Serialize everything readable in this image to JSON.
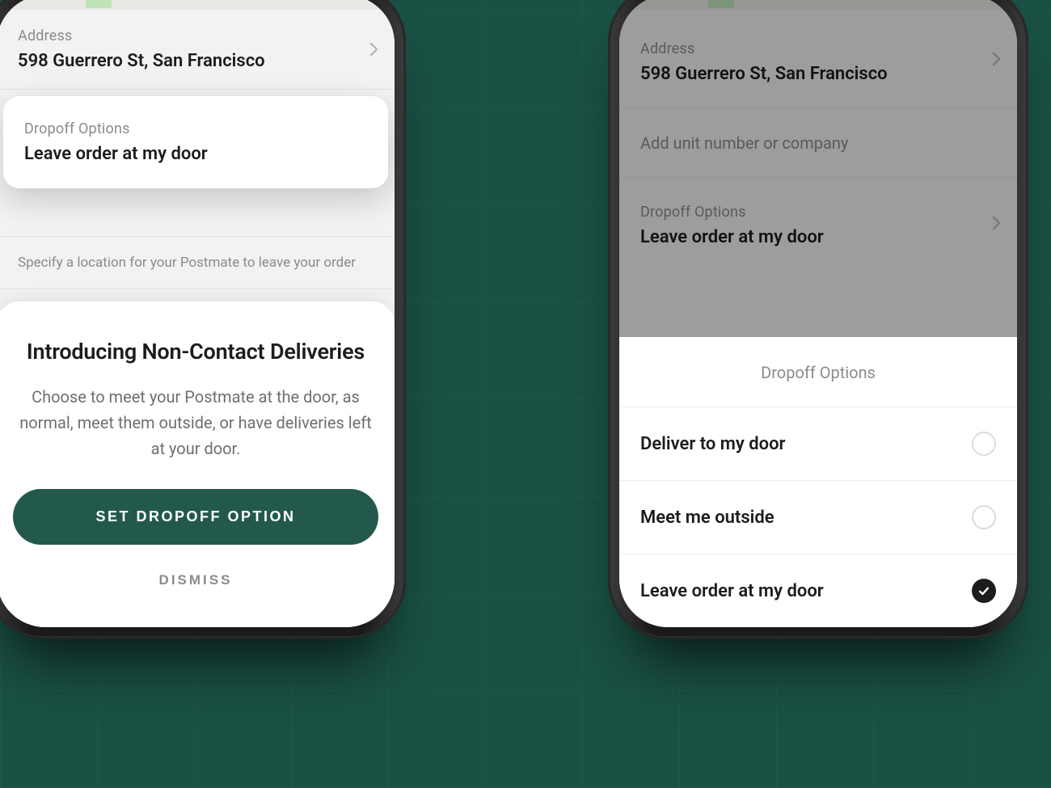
{
  "left": {
    "address_label": "Address",
    "address_value": "598 Guerrero St, San Francisco",
    "dropoff_label": "Dropoff Options",
    "dropoff_value": "Leave order at my door",
    "helper_text": "Specify a location for your Postmate to leave your order",
    "promo": {
      "title": "Introducing Non-Contact Deliveries",
      "body": "Choose to meet your Postmate at the door, as normal, meet them outside, or have deliveries left at your door.",
      "cta": "SET DROPOFF OPTION",
      "dismiss": "DISMISS"
    }
  },
  "right": {
    "address_label": "Address",
    "address_value": "598 Guerrero St, San Francisco",
    "unit_placeholder": "Add unit number or company",
    "dropoff_label": "Dropoff Options",
    "dropoff_value": "Leave order at my door",
    "options_title": "Dropoff Options",
    "options": [
      {
        "label": "Deliver to my door",
        "selected": false
      },
      {
        "label": "Meet me outside",
        "selected": false
      },
      {
        "label": "Leave order at my door",
        "selected": true
      }
    ]
  }
}
